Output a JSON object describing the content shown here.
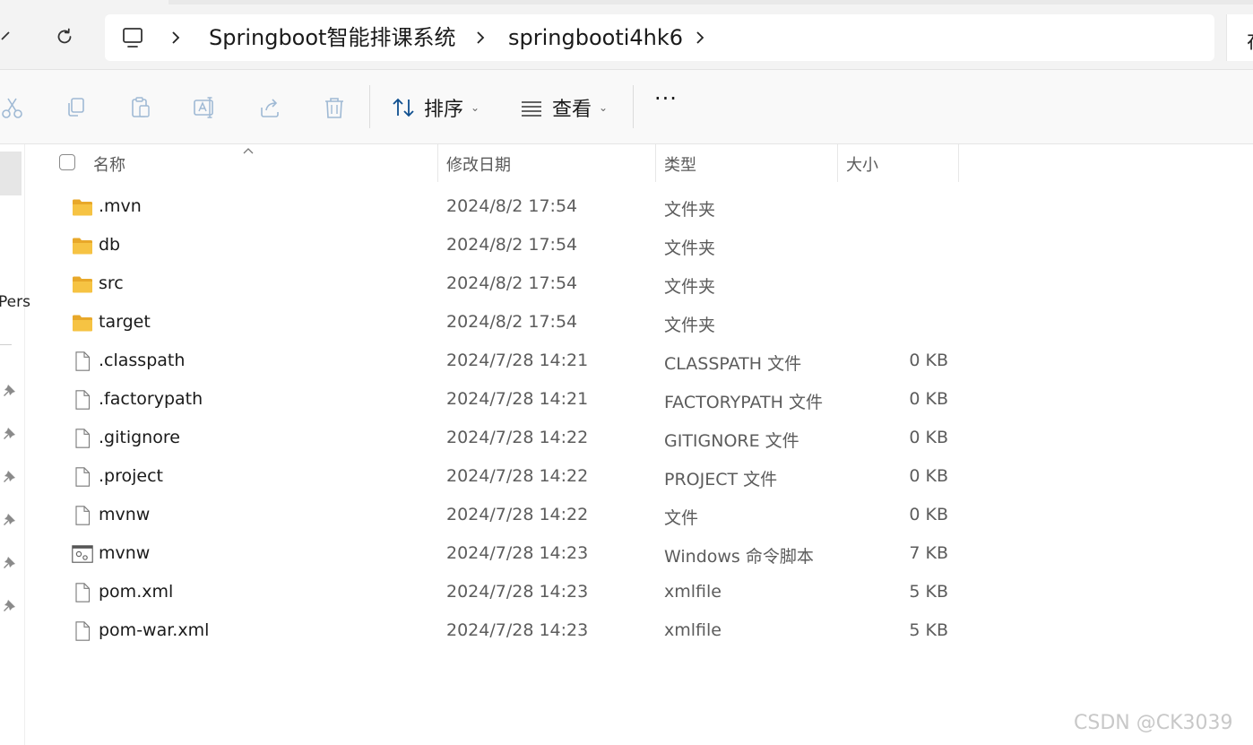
{
  "breadcrumb": {
    "items": [
      "Springboot智能排课系统",
      "springbooti4hk6"
    ],
    "search_partial": "在"
  },
  "commands": {
    "cut_icon": "scissors-icon",
    "copy_icon": "copy-icon",
    "paste_icon": "clipboard-icon",
    "rename_icon": "rename-icon",
    "share_icon": "share-icon",
    "delete_icon": "trash-icon",
    "sort_label": "排序",
    "view_label": "查看",
    "more_label": "···"
  },
  "nav": {
    "partial_label": "Pers"
  },
  "columns": {
    "name": "名称",
    "modified": "修改日期",
    "type": "类型",
    "size": "大小"
  },
  "files": [
    {
      "name": ".mvn",
      "modified": "2024/8/2 17:54",
      "type": "文件夹",
      "size": "",
      "kind": "folder"
    },
    {
      "name": "db",
      "modified": "2024/8/2 17:54",
      "type": "文件夹",
      "size": "",
      "kind": "folder"
    },
    {
      "name": "src",
      "modified": "2024/8/2 17:54",
      "type": "文件夹",
      "size": "",
      "kind": "folder"
    },
    {
      "name": "target",
      "modified": "2024/8/2 17:54",
      "type": "文件夹",
      "size": "",
      "kind": "folder"
    },
    {
      "name": ".classpath",
      "modified": "2024/7/28 14:21",
      "type": "CLASSPATH 文件",
      "size": "0 KB",
      "kind": "file"
    },
    {
      "name": ".factorypath",
      "modified": "2024/7/28 14:21",
      "type": "FACTORYPATH 文件",
      "size": "0 KB",
      "kind": "file"
    },
    {
      "name": ".gitignore",
      "modified": "2024/7/28 14:22",
      "type": "GITIGNORE 文件",
      "size": "0 KB",
      "kind": "file"
    },
    {
      "name": ".project",
      "modified": "2024/7/28 14:22",
      "type": "PROJECT 文件",
      "size": "0 KB",
      "kind": "file"
    },
    {
      "name": "mvnw",
      "modified": "2024/7/28 14:22",
      "type": "文件",
      "size": "0 KB",
      "kind": "file"
    },
    {
      "name": "mvnw",
      "modified": "2024/7/28 14:23",
      "type": "Windows 命令脚本",
      "size": "7 KB",
      "kind": "script"
    },
    {
      "name": "pom.xml",
      "modified": "2024/7/28 14:23",
      "type": "xmlfile",
      "size": "5 KB",
      "kind": "file"
    },
    {
      "name": "pom-war.xml",
      "modified": "2024/7/28 14:23",
      "type": "xmlfile",
      "size": "5 KB",
      "kind": "file"
    }
  ],
  "watermark": "CSDN @CK3039",
  "colors": {
    "folder": "#f6c343",
    "folder_dark": "#e8a82a",
    "icon_disabled": "#9fb9d4"
  }
}
